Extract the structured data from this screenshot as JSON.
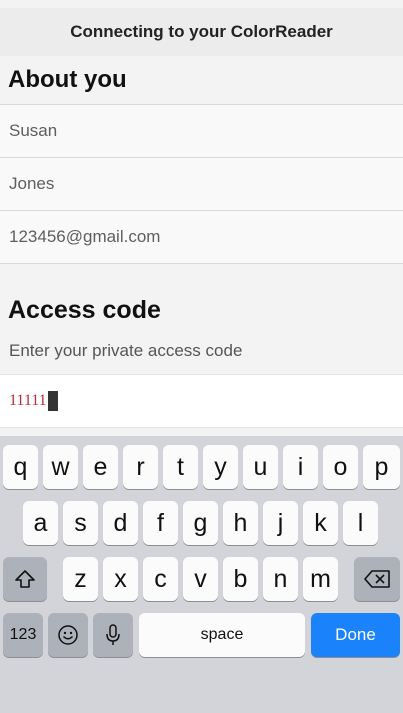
{
  "header": {
    "title": "Connecting to your ColorReader"
  },
  "about": {
    "title": "About you",
    "first_name": "Susan",
    "last_name": "Jones",
    "email": "123456@gmail.com"
  },
  "access": {
    "title": "Access code",
    "helper": "Enter your private access code",
    "code_value": "11111"
  },
  "keyboard": {
    "row1": [
      "q",
      "w",
      "e",
      "r",
      "t",
      "y",
      "u",
      "i",
      "o",
      "p"
    ],
    "row2": [
      "a",
      "s",
      "d",
      "f",
      "g",
      "h",
      "j",
      "k",
      "l"
    ],
    "row3": [
      "z",
      "x",
      "c",
      "v",
      "b",
      "n",
      "m"
    ],
    "numbers_label": "123",
    "space_label": "space",
    "done_label": "Done",
    "colors": {
      "done": "#1a82fb",
      "keyboard_bg": "#d2d4d9"
    }
  }
}
